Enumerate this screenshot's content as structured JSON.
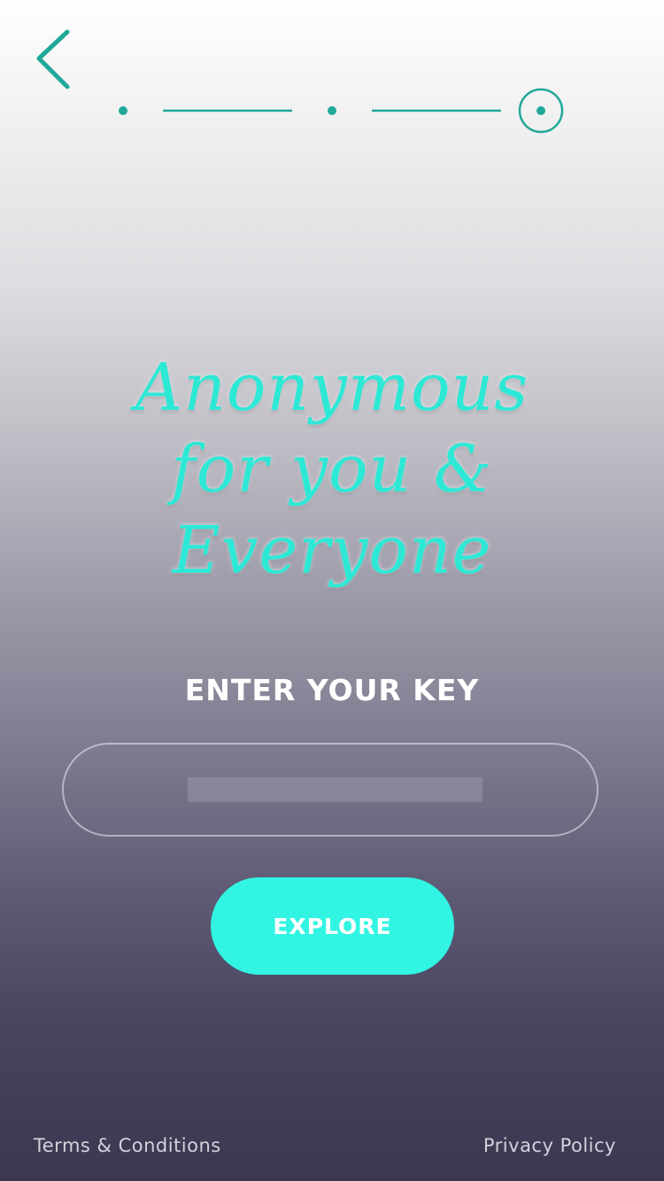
{
  "colors": {
    "accent": "#20a898",
    "button": "#31f5e2",
    "headline": "#2ee8d6"
  },
  "nav": {
    "back_icon": "chevron-left-icon"
  },
  "stepper": {
    "steps": 3,
    "current_step": 3
  },
  "headline": {
    "line1": "Anonymous",
    "line2": "for you &",
    "line3": "Everyone"
  },
  "key_form": {
    "label": "ENTER YOUR KEY",
    "value": "",
    "placeholder": ""
  },
  "actions": {
    "explore_label": "EXPLORE"
  },
  "footer": {
    "terms_label": "Terms & Conditions",
    "privacy_label": "Privacy Policy"
  }
}
